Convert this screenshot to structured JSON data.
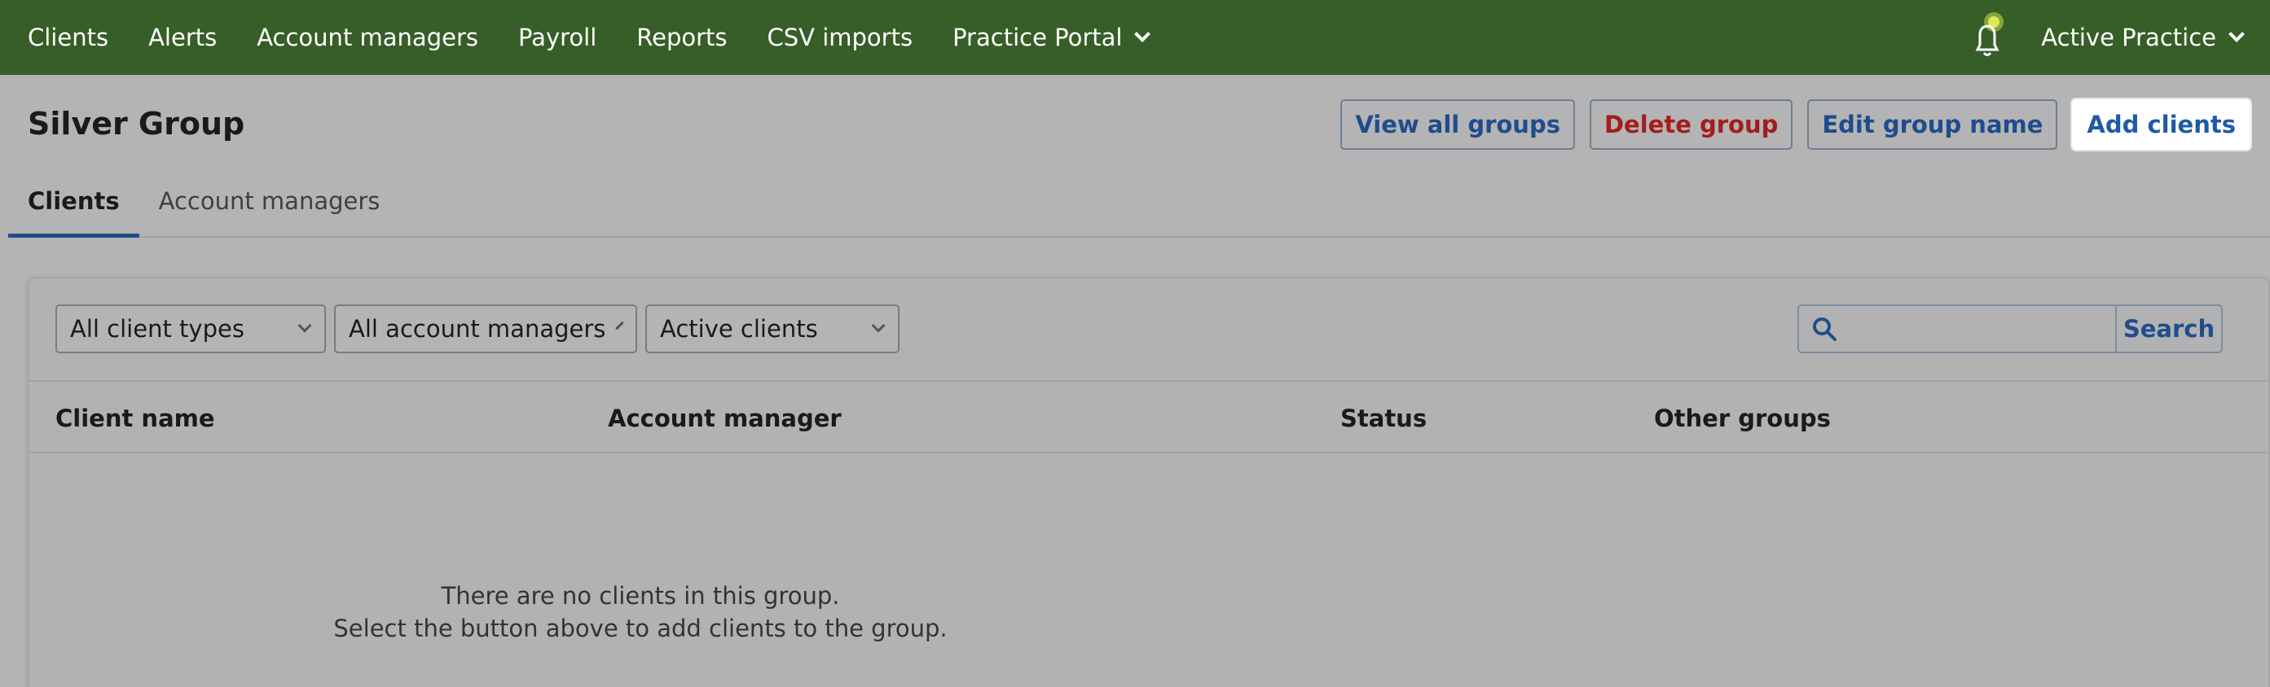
{
  "nav": {
    "items": [
      "Clients",
      "Alerts",
      "Account managers",
      "Payroll",
      "Reports",
      "CSV imports",
      "Practice Portal"
    ],
    "practice_label": "Active Practice"
  },
  "page": {
    "title": "Silver Group",
    "actions": {
      "view_all": "View all groups",
      "delete": "Delete group",
      "edit_name": "Edit group name",
      "add_clients": "Add clients"
    },
    "tabs": [
      "Clients",
      "Account managers"
    ]
  },
  "filters": {
    "client_type": "All client types",
    "account_manager": "All account managers",
    "status": "Active clients",
    "search_value": "",
    "search_button": "Search"
  },
  "table": {
    "columns": [
      "Client name",
      "Account manager",
      "Status",
      "Other groups"
    ],
    "empty_line1": "There are no clients in this group.",
    "empty_line2": "Select the button above to add clients to the group."
  },
  "colors": {
    "nav_bg": "#375e28",
    "accent_blue": "#1f4d8c",
    "danger_red": "#a31d1d",
    "notification_dot": "#c9e04a"
  }
}
